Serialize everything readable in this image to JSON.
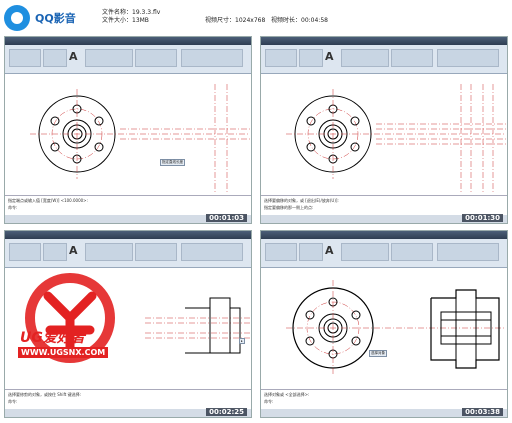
{
  "header": {
    "app_name": "QQ影音",
    "file_name_label": "文件名称：",
    "file_name": "19.3.3.flv",
    "file_size_label": "文件大小：",
    "file_size": "13MB",
    "video_size_label": "视频尺寸：",
    "video_size": "1024x768",
    "duration_label": "视频时长：",
    "duration": "00:04:58"
  },
  "panels": [
    {
      "timestamp": "00:01:03",
      "cmd_line1": "指定端点或输入值 [宽度(W)] <100.0000>:",
      "cmd_line2": "命令:",
      "tooltip": "指定直线长度"
    },
    {
      "timestamp": "00:01:30",
      "cmd_line1": "选择要偏移的对象，或 [退出(E)/放弃(U)]:",
      "cmd_line2": "指定要偏移的那一侧上的点:",
      "tooltip": ""
    },
    {
      "timestamp": "00:02:25",
      "cmd_line1": "选择要修剪的对象，或按住 Shift 键选择:",
      "cmd_line2": "命令:",
      "tooltip": ""
    },
    {
      "timestamp": "00:03:38",
      "cmd_line1": "选择对象或 <全部选择>:",
      "cmd_line2": "命令:",
      "tooltip": "选择对象"
    }
  ],
  "watermark": {
    "text": "UG爱好者",
    "url": "WWW.UGSNX.COM"
  },
  "colors": {
    "accent": "#1f8fe0",
    "watermark": "#e32222",
    "titlebar": "#2e3d52",
    "ribbon": "#dde6f0"
  }
}
